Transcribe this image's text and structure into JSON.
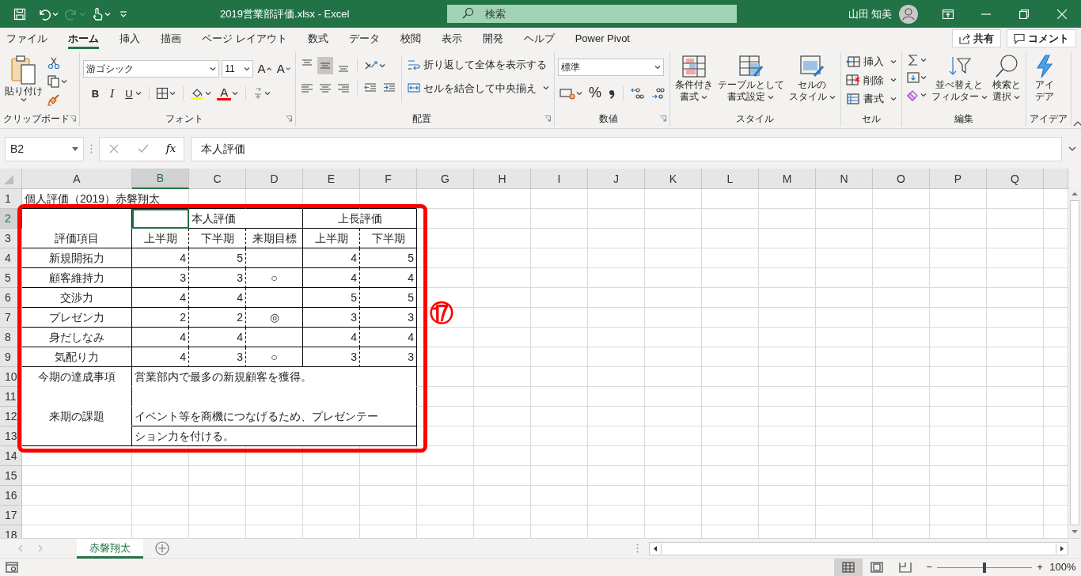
{
  "window": {
    "title": "2019営業部評価.xlsx  -  Excel",
    "user_name": "山田 知美"
  },
  "search": {
    "placeholder": "検索"
  },
  "ribbon_tabs": [
    {
      "label": "ファイル",
      "selected": false
    },
    {
      "label": "ホーム",
      "selected": true
    },
    {
      "label": "挿入",
      "selected": false
    },
    {
      "label": "描画",
      "selected": false
    },
    {
      "label": "ページ レイアウト",
      "selected": false
    },
    {
      "label": "数式",
      "selected": false
    },
    {
      "label": "データ",
      "selected": false
    },
    {
      "label": "校閲",
      "selected": false
    },
    {
      "label": "表示",
      "selected": false
    },
    {
      "label": "開発",
      "selected": false
    },
    {
      "label": "ヘルプ",
      "selected": false
    },
    {
      "label": "Power Pivot",
      "selected": false
    }
  ],
  "share_button": "共有",
  "comment_button": "コメント",
  "ribbon_groups": [
    {
      "kind": "clipboard",
      "label": "クリップボード",
      "paste_label": "貼り付け"
    },
    {
      "kind": "font",
      "label": "フォント",
      "font_name": "游ゴシック",
      "font_size": "11",
      "grow_font": "A",
      "shrink_font": "A",
      "bold": "B",
      "italic": "I",
      "underline": "U",
      "font_color": "A"
    },
    {
      "kind": "alignment",
      "label": "配置",
      "align_buttons": [
        {
          "kind": "top",
          "selected": false
        },
        {
          "kind": "middle",
          "selected": true
        },
        {
          "kind": "bottom",
          "selected": false
        },
        {
          "kind": "left",
          "selected": false
        },
        {
          "kind": "center",
          "selected": false
        },
        {
          "kind": "right",
          "selected": false
        }
      ],
      "wrap_text": "折り返して全体を表示する",
      "merge_center": "セルを結合して中央揃え"
    },
    {
      "kind": "number",
      "label": "数値",
      "number_format": "標準",
      "percent": "%"
    },
    {
      "kind": "styles",
      "label": "スタイル",
      "buttons": [
        {
          "lines": [
            "条件付き",
            "書式"
          ]
        },
        {
          "lines": [
            "テーブルとして",
            "書式設定"
          ]
        },
        {
          "lines": [
            "セルの",
            "スタイル"
          ]
        }
      ]
    },
    {
      "kind": "cells",
      "label": "セル",
      "buttons": [
        "挿入",
        "削除",
        "書式"
      ]
    },
    {
      "kind": "editing",
      "label": "編集",
      "buttons": [
        {
          "lines": [
            "並べ替えと",
            "フィルター"
          ]
        },
        {
          "lines": [
            "検索と",
            "選択"
          ]
        }
      ]
    },
    {
      "kind": "ideas",
      "label": "アイデア",
      "button_lines": [
        "アイ",
        "デア"
      ]
    }
  ],
  "formula_bar": {
    "name_box": "B2",
    "function_button": "fx",
    "formula": "本人評価"
  },
  "sheet": {
    "columns": [
      {
        "label": "A",
        "selected": false
      },
      {
        "label": "B",
        "selected": true
      },
      {
        "label": "C",
        "selected": false
      },
      {
        "label": "D",
        "selected": false
      },
      {
        "label": "E",
        "selected": false
      },
      {
        "label": "F",
        "selected": false
      },
      {
        "label": "G",
        "selected": false
      },
      {
        "label": "H",
        "selected": false
      },
      {
        "label": "I",
        "selected": false
      },
      {
        "label": "J",
        "selected": false
      },
      {
        "label": "K",
        "selected": false
      },
      {
        "label": "L",
        "selected": false
      },
      {
        "label": "M",
        "selected": false
      },
      {
        "label": "N",
        "selected": false
      },
      {
        "label": "O",
        "selected": false
      },
      {
        "label": "P",
        "selected": false
      },
      {
        "label": "Q",
        "selected": false
      }
    ],
    "rows": [
      {
        "label": "1",
        "selected": false,
        "kind": "title",
        "title": "個人評価（2019）赤磐翔太"
      },
      {
        "label": "2",
        "selected": true,
        "kind": "group-header",
        "self_label": "本人評価",
        "boss_label": "上長評価"
      },
      {
        "label": "3",
        "selected": false,
        "kind": "header",
        "cells": [
          "評価項目",
          "上半期",
          "下半期",
          "来期目標",
          "上半期",
          "下半期"
        ]
      },
      {
        "label": "4",
        "selected": false,
        "kind": "score",
        "item": "新規開拓力",
        "self_first": "4",
        "self_second": "5",
        "boss_first": "4",
        "boss_second": "5"
      },
      {
        "label": "5",
        "selected": false,
        "kind": "score",
        "item": "顧客維持力",
        "self_first": "3",
        "self_second": "3",
        "goal": "○",
        "boss_first": "4",
        "boss_second": "4"
      },
      {
        "label": "6",
        "selected": false,
        "kind": "score",
        "item": "交渉力",
        "self_first": "4",
        "self_second": "4",
        "boss_first": "5",
        "boss_second": "5"
      },
      {
        "label": "7",
        "selected": false,
        "kind": "score",
        "item": "プレゼン力",
        "self_first": "2",
        "self_second": "2",
        "goal": "◎",
        "boss_first": "3",
        "boss_second": "3"
      },
      {
        "label": "8",
        "selected": false,
        "kind": "score",
        "item": "身だしなみ",
        "self_first": "4",
        "self_second": "4",
        "boss_first": "4",
        "boss_second": "4"
      },
      {
        "label": "9",
        "selected": false,
        "kind": "score",
        "item": "気配り力",
        "self_first": "4",
        "self_second": "3",
        "goal": "○",
        "boss_first": "3",
        "boss_second": "3"
      },
      {
        "label": "10",
        "selected": false,
        "kind": "note",
        "note_label": "今期の達成事項",
        "text": "営業部内で最多の新規顧客を獲得。"
      },
      {
        "label": "11",
        "selected": false,
        "kind": "note-blank"
      },
      {
        "label": "12",
        "selected": false,
        "kind": "note-top",
        "note_label": "来期の課題",
        "text": "イベント等を商機につなげるため、プレゼンテー"
      },
      {
        "label": "13",
        "selected": false,
        "kind": "note-end",
        "text": "ション力を付ける。"
      },
      {
        "label": "14",
        "selected": false,
        "kind": "empty"
      },
      {
        "label": "15",
        "selected": false,
        "kind": "empty"
      },
      {
        "label": "16",
        "selected": false,
        "kind": "empty"
      },
      {
        "label": "17",
        "selected": false,
        "kind": "empty"
      },
      {
        "label": "18",
        "selected": false,
        "kind": "empty"
      }
    ]
  },
  "annotation": {
    "label": "⑰"
  },
  "sheet_tabs": [
    {
      "label": "赤磐翔太",
      "selected": true
    }
  ],
  "status_bar": {
    "views": [
      {
        "kind": "normal",
        "selected": true
      },
      {
        "kind": "page-layout",
        "selected": false
      },
      {
        "kind": "page-break",
        "selected": false
      }
    ],
    "zoom_minus": "−",
    "zoom_plus": "+",
    "zoom_slider": {
      "level": 0.5
    },
    "zoom": "100%"
  }
}
